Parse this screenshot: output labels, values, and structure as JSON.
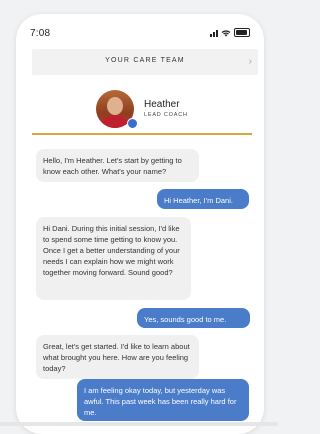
{
  "status": {
    "time": "7:08"
  },
  "header": {
    "title": "YOUR CARE TEAM",
    "chevron": "›"
  },
  "coach": {
    "name": "Heather",
    "role": "LEAD COACH"
  },
  "messages": [
    {
      "from": "coach",
      "text": "Hello, I'm Heather. Let's start by getting to know each other. What's your name?"
    },
    {
      "from": "user",
      "text": "Hi Heather, I'm Dani."
    },
    {
      "from": "coach",
      "text": "Hi Dani. During this initial session, I'd like to spend some time getting to know you. Once I get a better understanding of your needs I can explain how we might work together moving forward. Sound good?"
    },
    {
      "from": "user",
      "text": "Yes, sounds good to me."
    },
    {
      "from": "coach",
      "text": "Great, let's get started. I'd like to learn about what brought you here. How are you feeling today?"
    },
    {
      "from": "user",
      "text": "I am feeling okay today, but yesterday was awful. This past week has been really hard for me."
    }
  ],
  "colors": {
    "accent": "#d8a838",
    "user_bubble": "#4a7cc9",
    "coach_bubble": "#f0f0f0"
  }
}
